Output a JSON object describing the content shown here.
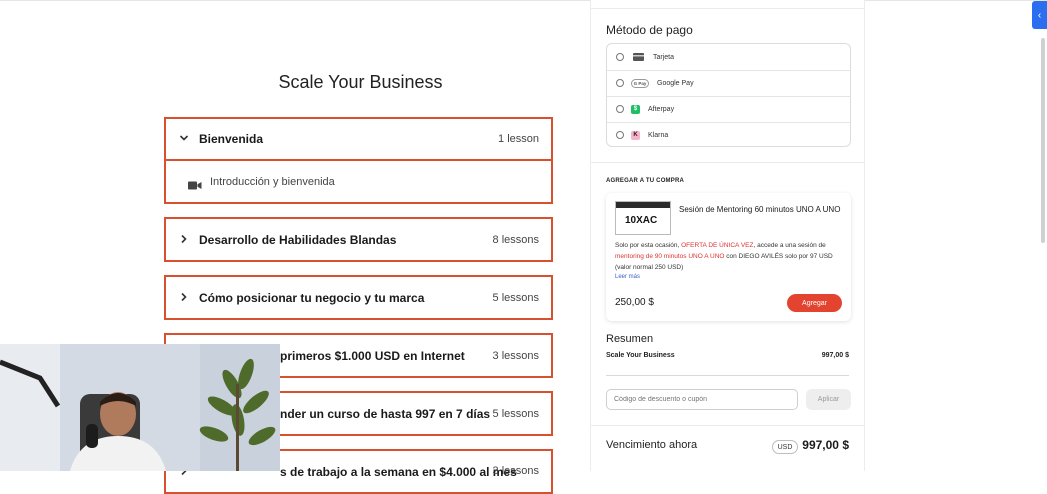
{
  "course": {
    "title": "Scale Your Business",
    "modules": [
      {
        "name": "Bienvenida",
        "count": "1 lesson",
        "expanded": true
      },
      {
        "name": "Desarrollo de Habilidades Blandas",
        "count": "8 lessons"
      },
      {
        "name": "Cómo posicionar tu negocio y tu marca",
        "count": "5 lessons"
      },
      {
        "name": "primeros $1.000 USD en Internet",
        "count": "3 lessons"
      },
      {
        "name": "nder un curso de hasta 997 en 7 días",
        "count": "5 lessons"
      },
      {
        "name": "s de trabajo a la semana en $4.000 al mes",
        "count": "3 lessons"
      }
    ],
    "lesson": "Introducción y bienvenida"
  },
  "checkout": {
    "payment_title": "Método de pago",
    "payment_options": [
      {
        "label": "Tarjeta",
        "icon": "card-icon"
      },
      {
        "label": "Google Pay",
        "icon": "gpay-icon",
        "badge": "G Pay"
      },
      {
        "label": "Afterpay",
        "icon": "afterpay-icon",
        "badge": "$"
      },
      {
        "label": "Klarna",
        "icon": "klarna-icon",
        "badge": "K"
      }
    ],
    "addon": {
      "header": "AGREGAR A TU COMPRA",
      "thumb_text": "10XAC",
      "title": "Sesión de Mentoring 60 minutos UNO A UNO",
      "desc_1": "Solo por esta ocasión, ",
      "desc_2": "OFERTA DE ÚNICA VEZ",
      "desc_3": ", accede a una sesión de ",
      "desc_4": "mentoring de 90 minutos UNO A UNO",
      "desc_5": " con DIEGO AVILÉS solo por 97 USD (valor normal 250 USD)",
      "read_more": "Leer más",
      "price": "250,00 $",
      "button": "Agregar"
    },
    "summary": {
      "title": "Resumen",
      "item": "Scale Your Business",
      "item_price": "997,00 $"
    },
    "coupon": {
      "placeholder": "Código de descuento o cupón",
      "button": "Aplicar"
    },
    "due": {
      "label": "Vencimiento ahora",
      "currency": "USD",
      "total": "997,00 $"
    }
  },
  "side_tab_icon": "‹",
  "colors": {
    "accent": "#d9502f",
    "button": "#e2442f",
    "side_tab": "#2b6ff0"
  }
}
